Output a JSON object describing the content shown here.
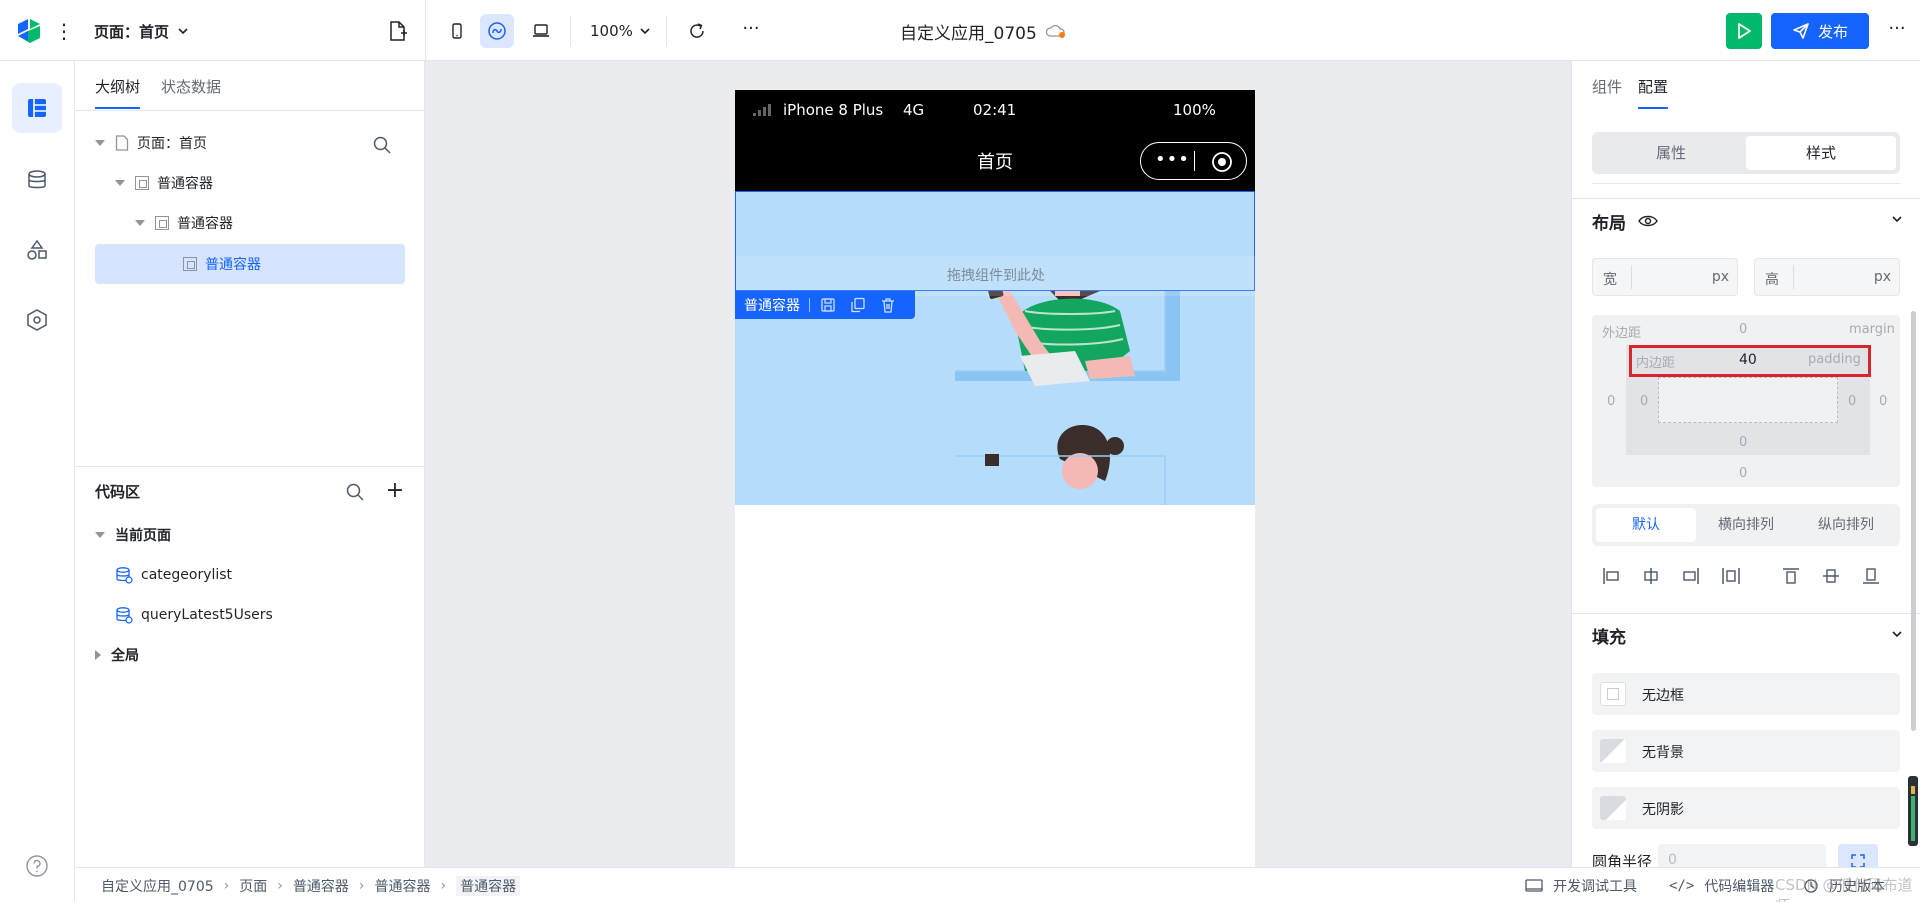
{
  "header": {
    "page_selector": "页面：首页",
    "zoom": "100%",
    "app_title": "自定义应用_0705",
    "publish_label": "发布"
  },
  "outline": {
    "tabs": [
      "大纲树",
      "状态数据"
    ],
    "tree": [
      {
        "label": "页面：首页",
        "depth": 0
      },
      {
        "label": "普通容器",
        "depth": 1
      },
      {
        "label": "普通容器",
        "depth": 2
      },
      {
        "label": "普通容器",
        "depth": 3,
        "selected": true
      }
    ]
  },
  "code_area": {
    "title": "代码区",
    "current_page": "当前页面",
    "items": [
      "categeorylist",
      "queryLatest5Users"
    ],
    "global": "全局"
  },
  "phone": {
    "carrier": "iPhone 8 Plus",
    "network": "4G",
    "time": "02:41",
    "battery": "100%",
    "nav_title": "首页",
    "drop_hint": "拖拽组件到此处",
    "selection_label": "普通容器"
  },
  "right_panel": {
    "tabs": [
      "组件",
      "配置"
    ],
    "segment": [
      "属性",
      "样式"
    ],
    "layout_title": "布局",
    "width_label": "宽",
    "height_label": "高",
    "unit": "px",
    "box_model": {
      "margin_label": "外边距",
      "margin_en": "margin",
      "margin_top": "0",
      "margin_left": "0",
      "margin_right": "0",
      "margin_bottom": "0",
      "padding_label": "内边距",
      "padding_en": "padding",
      "padding_top": "40",
      "padding_left": "0",
      "padding_right": "0",
      "padding_bottom": "0"
    },
    "arrange": [
      "默认",
      "横向排列",
      "纵向排列"
    ],
    "fill_title": "填充",
    "fill_items": [
      "无边框",
      "无背景",
      "无阴影"
    ],
    "radius_label": "圆角半径",
    "radius_placeholder": "0"
  },
  "bottom_bar": {
    "breadcrumb": [
      "自定义应用_0705",
      "页面",
      "普通容器",
      "普通容器",
      "普通容器"
    ],
    "devtools": "开发调试工具",
    "code_editor": "代码编辑器",
    "history": "历史版本",
    "watermark": "CSDN @低代码布道师"
  },
  "colors": {
    "brand": "#1664ff",
    "run": "#00b96b",
    "highlight_box": "#d9262c",
    "container_bg": "#b6dcfb"
  }
}
